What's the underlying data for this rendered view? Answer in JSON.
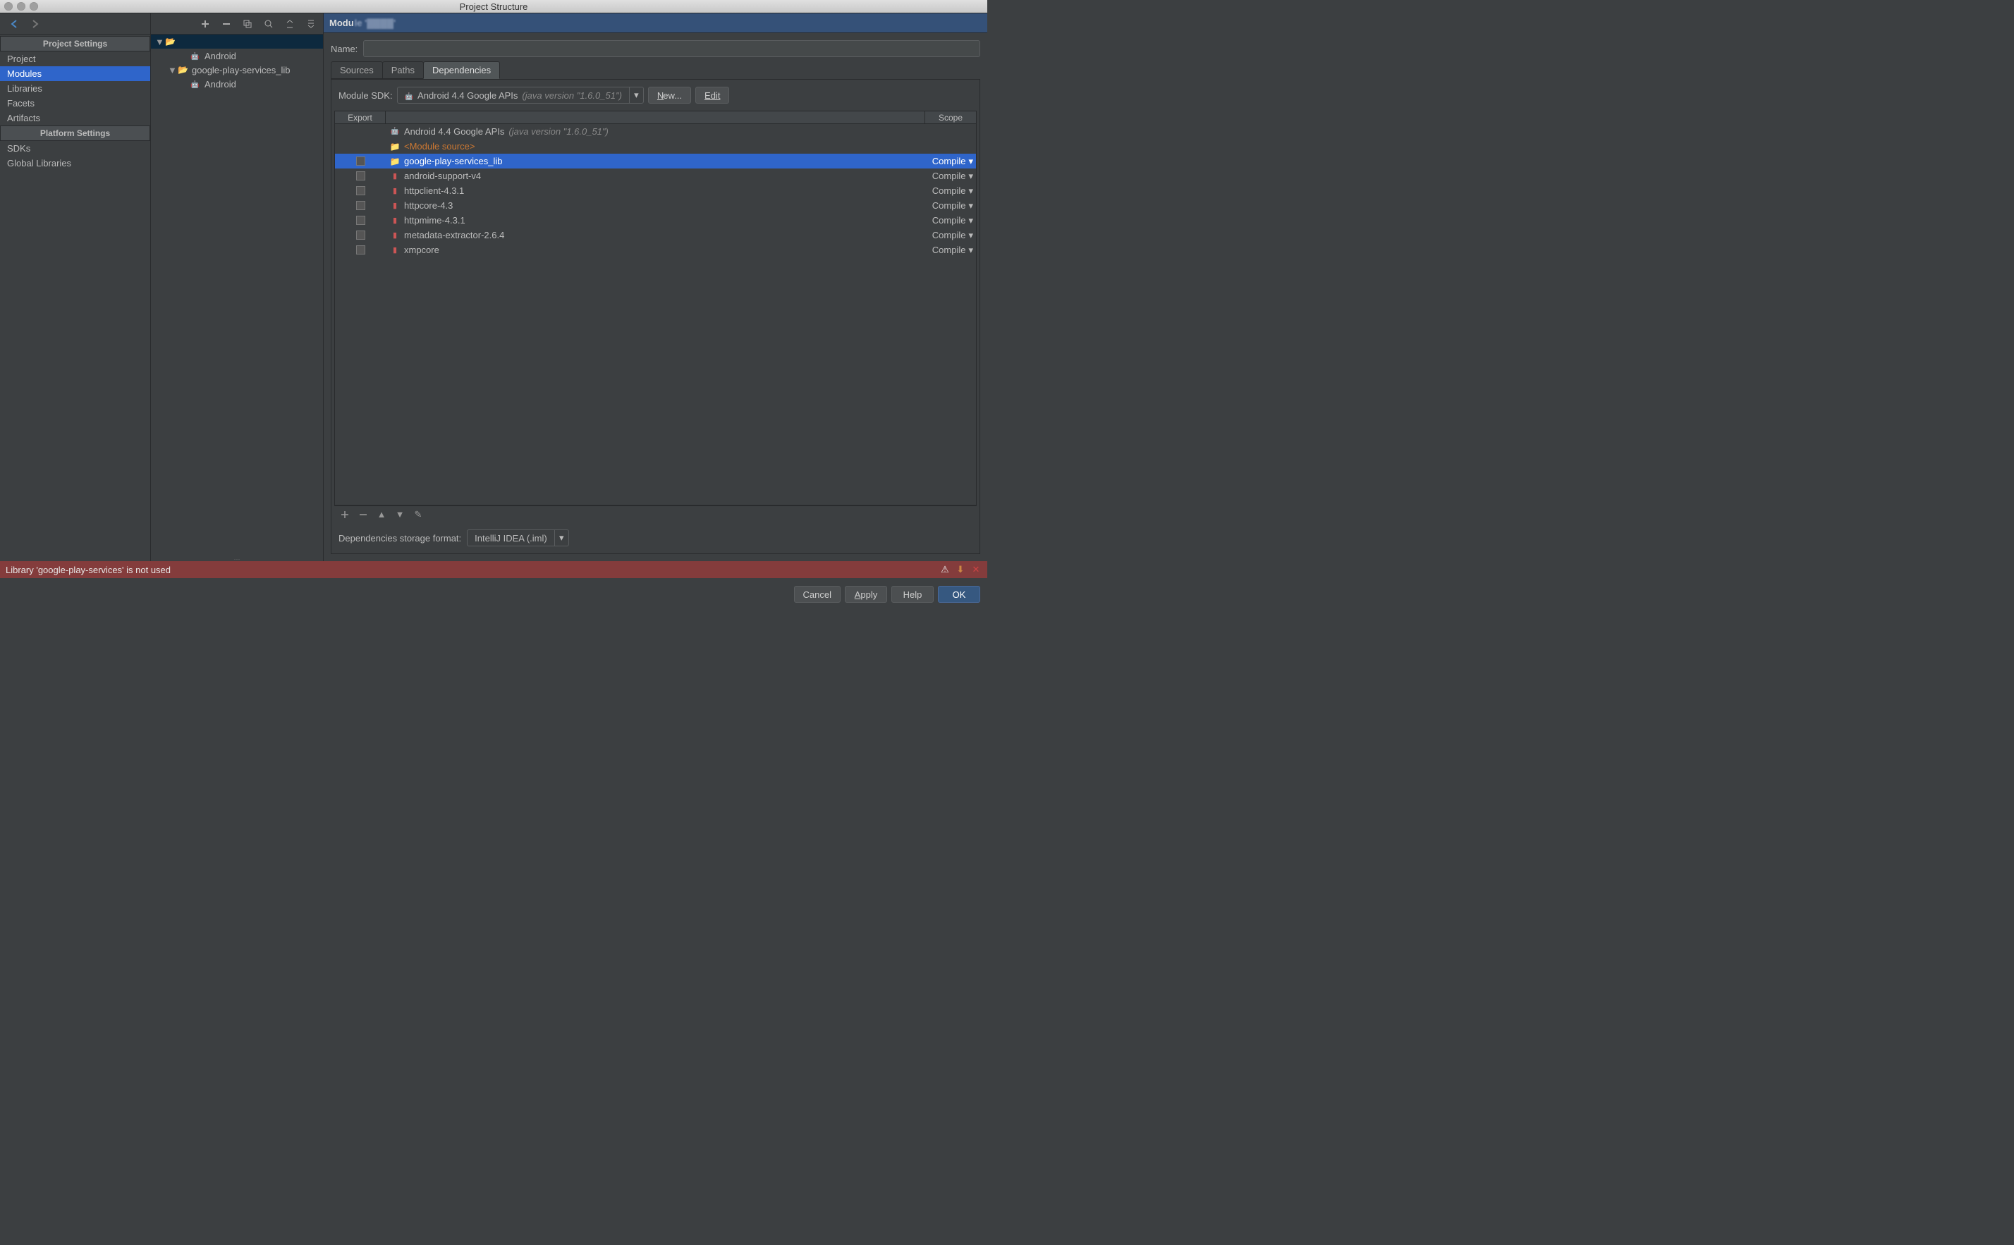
{
  "window": {
    "title": "Project Structure"
  },
  "sidebar": {
    "section1": "Project Settings",
    "section2": "Platform Settings",
    "items1": [
      "Project",
      "Modules",
      "Libraries",
      "Facets",
      "Artifacts"
    ],
    "items2": [
      "SDKs",
      "Global Libraries"
    ],
    "selected": "Modules"
  },
  "tree": {
    "root": {
      "label": ""
    },
    "children": [
      {
        "label": "Android",
        "indent": 2,
        "type": "android"
      },
      {
        "label": "google-play-services_lib",
        "indent": 1,
        "type": "folder",
        "expanded": true
      },
      {
        "label": "Android",
        "indent": 2,
        "type": "android"
      }
    ]
  },
  "module": {
    "header": "Modu",
    "name_label": "Name:",
    "name_value": ""
  },
  "tabs": [
    "Sources",
    "Paths",
    "Dependencies"
  ],
  "active_tab": "Dependencies",
  "sdk": {
    "label": "Module SDK:",
    "value": "Android 4.4 Google APIs",
    "version": "(java version \"1.6.0_51\")",
    "new_btn": "New...",
    "edit_btn": "Edit"
  },
  "table": {
    "headers": {
      "export": "Export",
      "scope": "Scope"
    },
    "rows": [
      {
        "export": null,
        "icon": "android",
        "name": "Android 4.4 Google APIs",
        "extra": "(java version \"1.6.0_51\")",
        "scope": null
      },
      {
        "export": null,
        "icon": "module-src",
        "name": "<Module source>",
        "class": "module-src",
        "scope": null
      },
      {
        "export": false,
        "icon": "folder",
        "name": "google-play-services_lib",
        "scope": "Compile",
        "selected": true
      },
      {
        "export": false,
        "icon": "jar",
        "name": "android-support-v4",
        "scope": "Compile"
      },
      {
        "export": false,
        "icon": "jar",
        "name": "httpclient-4.3.1",
        "scope": "Compile"
      },
      {
        "export": false,
        "icon": "jar",
        "name": "httpcore-4.3",
        "scope": "Compile"
      },
      {
        "export": false,
        "icon": "jar",
        "name": "httpmime-4.3.1",
        "scope": "Compile"
      },
      {
        "export": false,
        "icon": "jar",
        "name": "metadata-extractor-2.6.4",
        "scope": "Compile"
      },
      {
        "export": false,
        "icon": "jar",
        "name": "xmpcore",
        "scope": "Compile"
      }
    ]
  },
  "storage": {
    "label": "Dependencies storage format:",
    "value": "IntelliJ IDEA (.iml)"
  },
  "status": {
    "message": "Library 'google-play-services' is not used"
  },
  "buttons": {
    "cancel": "Cancel",
    "apply": "Apply",
    "help": "Help",
    "ok": "OK"
  }
}
